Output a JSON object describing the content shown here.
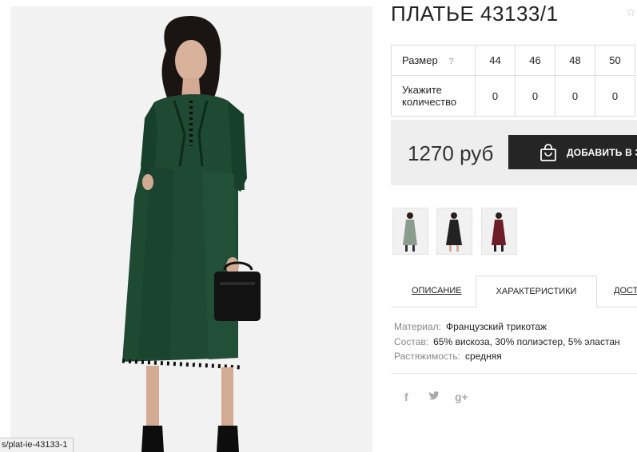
{
  "product": {
    "title": "ПЛАТЬЕ 43133/1",
    "image_alt": "Платье",
    "favorite_icon": "star-icon"
  },
  "size_table": {
    "size_label": "Размер",
    "help_glyph": "?",
    "quantity_label": "Укажите количество",
    "sizes": [
      "44",
      "46",
      "48",
      "50"
    ],
    "quantities": [
      "0",
      "0",
      "0",
      "0"
    ]
  },
  "purchase": {
    "price": "1270 руб",
    "add_to_cart_label": "ДОБАВИТЬ В ЗАКАЗ",
    "add_to_cart_icon": "shopping-bag-icon"
  },
  "thumbnails": [
    {
      "name": "thumbnail-green",
      "color": "#8a9c8d"
    },
    {
      "name": "thumbnail-black",
      "color": "#222222"
    },
    {
      "name": "thumbnail-burgundy",
      "color": "#6f1d26"
    }
  ],
  "tabs": [
    {
      "label": "ОПИСАНИЕ"
    },
    {
      "label": "ХАРАКТЕРИСТИКИ"
    },
    {
      "label": "ДОСТАВКА"
    }
  ],
  "specs": [
    {
      "key": "Материал:",
      "value": "Французский трикотаж"
    },
    {
      "key": "Состав:",
      "value": "65% вискоза, 30% полиэстер, 5% эластан"
    },
    {
      "key": "Растяжимость:",
      "value": "средняя"
    }
  ],
  "social": [
    {
      "name": "facebook-icon",
      "glyph": "f"
    },
    {
      "name": "twitter-icon",
      "glyph": "🐦"
    },
    {
      "name": "google-plus-icon",
      "glyph": "g+"
    }
  ],
  "status_bar": {
    "url": "s/plat-ie-43133-1"
  },
  "colors": {
    "dress_green": "#1e4a34",
    "button_dark": "#252525",
    "price_box_bg": "#eeeeee"
  }
}
